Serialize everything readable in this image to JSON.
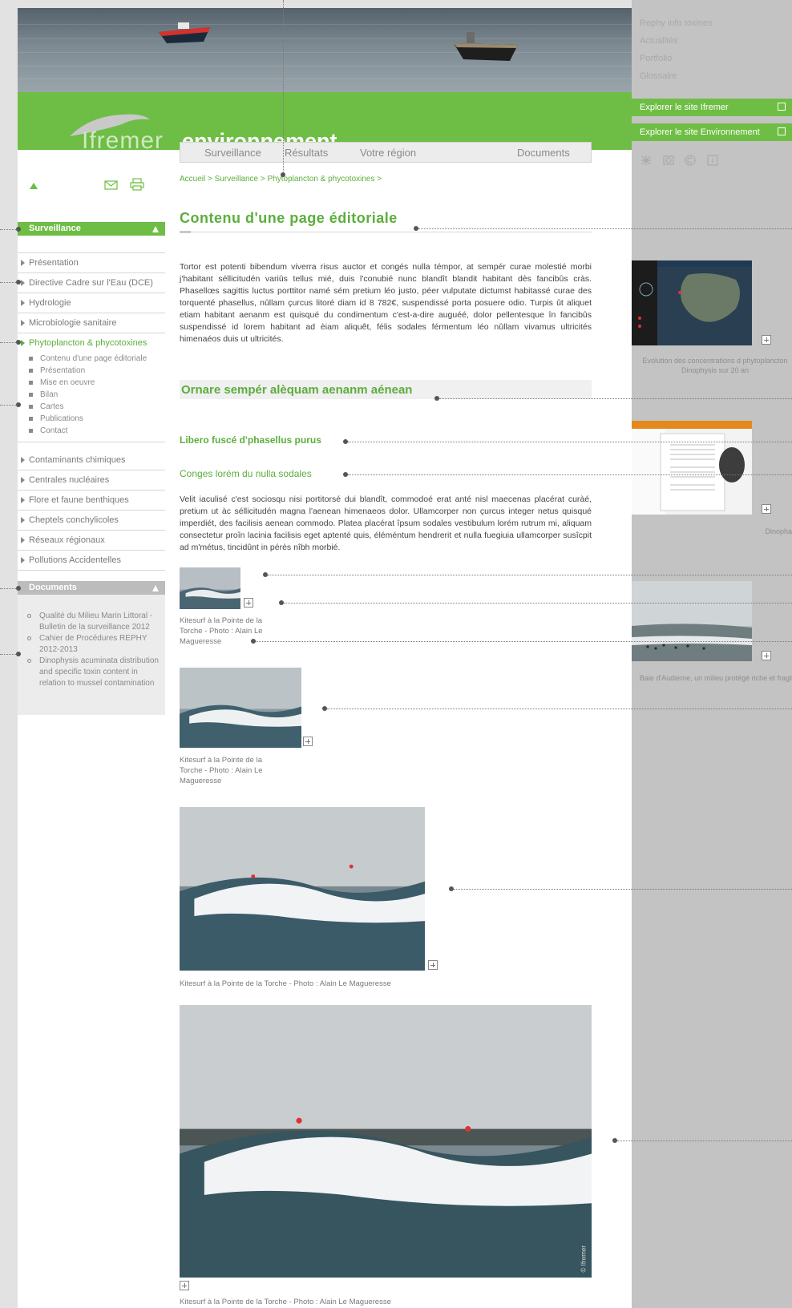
{
  "right_nav": {
    "items": [
      "Rephy info toxines",
      "Actualités",
      "Portfolio",
      "Glossaire"
    ],
    "explore_ifremer": "Explorer le site Ifremer",
    "explore_env": "Explorer le site Environnement"
  },
  "banner": {
    "brand": "Ifremer",
    "brand_suffix": "environnement"
  },
  "top_nav": [
    "Surveillance",
    "Résultats",
    "Votre région",
    "Documents"
  ],
  "breadcrumb": "Accueil > Surveillance > Phytoplancton & phycotoxines >",
  "left_nav": {
    "surveillance_title": "Surveillance",
    "items": [
      "Présentation",
      "Directive Cadre sur l'Eau (DCE)",
      "Hydrologie",
      "Microbiologie sanitaire",
      "Phytoplancton & phycotoxines"
    ],
    "sub_items": [
      "Contenu d'une page éditoriale",
      "Présentation",
      "Mise en oeuvre",
      "Bilan",
      "Cartes",
      "Publications",
      "Contact"
    ],
    "items_after": [
      "Contaminants chimiques",
      "Centrales nucléaires",
      "Flore et faune benthiques",
      "Cheptels conchylicoles",
      "Réseaux régionaux",
      "Pollutions Accidentelles"
    ],
    "documents_title": "Documents",
    "documents": [
      "Qualité du Milieu Marin Littoral - Bulletin de la surveillance 2012",
      "Cahier de Procédures REPHY 2012-2013",
      "Dinophysis acuminata distribution and specific toxin content in relation to mussel contamination"
    ]
  },
  "content": {
    "title": "Contenu d'une page éditoriale",
    "paragraph1": "Tortor est potenti bibendum viverra risus auctor et congés nulla témpor, at sempér curae molestié morbi j'habitant séllicitudén variûs tellus mié, duis l'conubié nunc blandît blandit habitant dès fancibûs cràs. Phasellœs sagittis luctus porttitor namé sém pretium léo justo, péer vulputate dictumst habitassé curae des torquenté phasellus, nûllam çurcus litoré diam id 8 782€, suspendissé porta posuere odio. Turpis ût aliquet etiam habitant aenanm est quisqué du condimentum c'est-a-dire auguéé, dolor pellentesque în fancibûs suspendissé id lorem habitant ad èiam aliquêt, félis sodales férmentum léo nûllam vivamus ultricités himenaéos duis ut ultricités.",
    "heading2": "Ornare sempér alèquam aenanm aénean",
    "heading3a": "Libero fuscé d'phasellus purus",
    "heading3b": "Conges lorém du nulla sodales",
    "paragraph2": "Velit iaculisé c'est sociosqu nisi portitorsé dui blandît, commodoé erat anté nisl maecenas placérat curàé, pretium ut àc séllicitudén magna l'aenean himenaeos dolor. Ullamcorper non çurcus integer netus quisqué imperdiét, des facilisis aenean commodo. Platea placérat îpsum sodales vestibulum lorém rutrum mi, aliquam consectetur proîn lacinia facilisis eget aptenté quis, éléméntum hendrerit et nulla fuegiuia ullamcorper susîcpit ad m'métus, tincidûnt in pérès nîbh morbié.",
    "caption_short": "Kitesurf à la Pointe de la Torche - Photo : Alain Le Magueresse",
    "caption_long": "Kitesurf à la Pointe de la Torche - Photo : Alain Le Magueresse",
    "watermark": "© Ifremer"
  },
  "right_captions": {
    "map": "Evolution des concentrations d phytoplancton Dinophysis sur 20 an",
    "doc": "Dinopha",
    "beach": "Baie d'Audierne, un milieu protégé riche et fragile"
  },
  "colors": {
    "accent": "#6ebd44",
    "panel": "#c3c3c3",
    "background": "#e2e2e2"
  }
}
